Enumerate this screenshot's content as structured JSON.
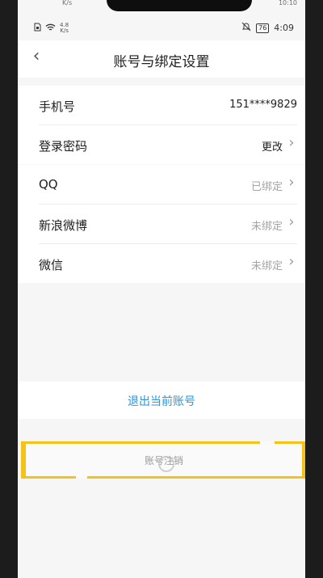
{
  "ghost_status": {
    "speed_top": "K/s",
    "time_top": "10:10"
  },
  "status_bar": {
    "speed_value": "4.8",
    "speed_unit": "K/s",
    "battery": "76",
    "time": "4:09"
  },
  "header": {
    "title": "账号与绑定设置"
  },
  "account_group": [
    {
      "label": "手机号",
      "value": "151****9829"
    },
    {
      "label": "登录密码",
      "value": "更改"
    }
  ],
  "binding_group": [
    {
      "label": "QQ",
      "value": "已绑定"
    },
    {
      "label": "新浪微博",
      "value": "未绑定"
    },
    {
      "label": "微信",
      "value": "未绑定"
    }
  ],
  "logout_label": "退出当前账号",
  "cancel_label": "账号注销",
  "colors": {
    "accent": "#2d96d8",
    "highlight": "#f5c218"
  }
}
